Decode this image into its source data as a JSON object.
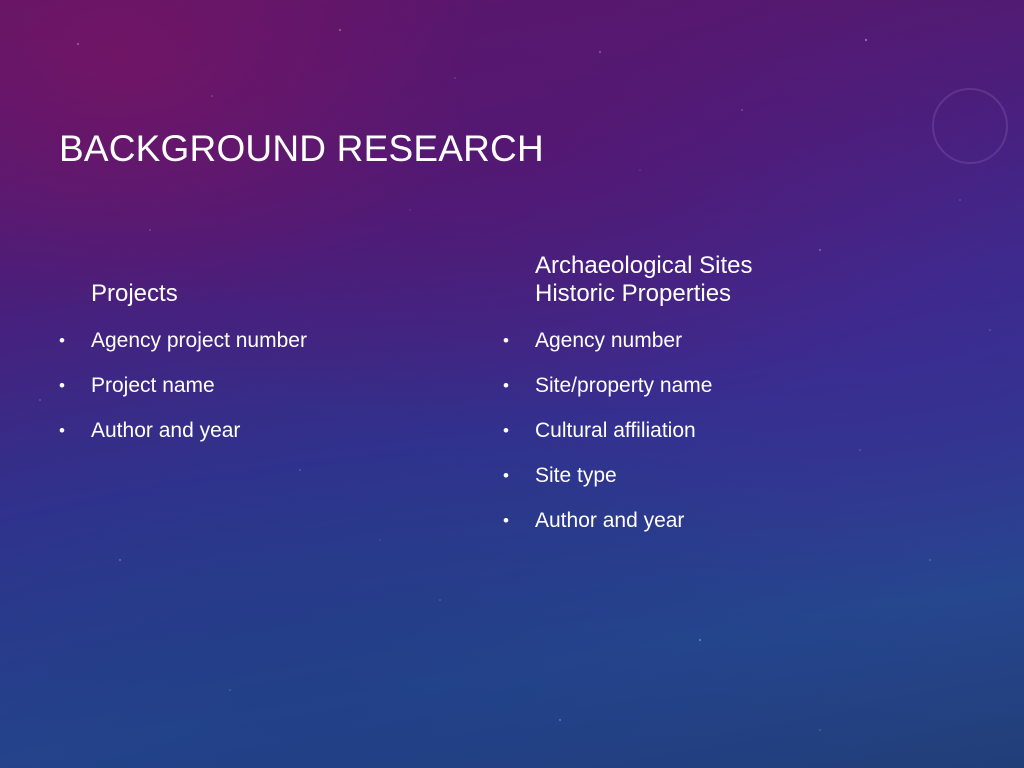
{
  "slide": {
    "title": "BACKGROUND RESEARCH",
    "left_column": {
      "heading": "Projects",
      "items": [
        "Agency project number",
        "Project name",
        "Author and year"
      ]
    },
    "right_column": {
      "heading_line_1": "Archaeological Sites",
      "heading_line_2": "Historic Properties",
      "items": [
        "Agency number",
        "Site/property name",
        "Cultural affiliation",
        "Site type",
        "Author and year"
      ]
    },
    "bullet_glyph": "•"
  },
  "colors": {
    "text": "#ffffff",
    "background_top": "#5e1668",
    "background_bottom": "#223e78"
  }
}
